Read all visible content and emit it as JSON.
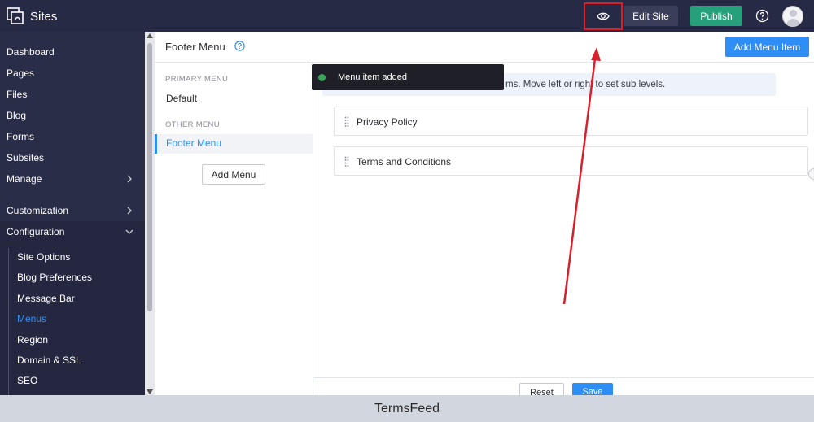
{
  "app": {
    "name": "Sites"
  },
  "topbar": {
    "edit_label": "Edit Site",
    "publish_label": "Publish",
    "icons": [
      "preview-eye-icon",
      "help-icon",
      "avatar"
    ]
  },
  "sidebar": {
    "items": [
      {
        "label": "Dashboard"
      },
      {
        "label": "Pages"
      },
      {
        "label": "Files"
      },
      {
        "label": "Blog"
      },
      {
        "label": "Forms"
      },
      {
        "label": "Subsites"
      },
      {
        "label": "Manage"
      },
      {
        "label": "Customization"
      },
      {
        "label": "Configuration"
      }
    ],
    "sub_items": [
      {
        "label": "Site Options"
      },
      {
        "label": "Blog Preferences"
      },
      {
        "label": "Message Bar"
      },
      {
        "label": "Menus"
      },
      {
        "label": "Region"
      },
      {
        "label": "Domain & SSL"
      },
      {
        "label": "SEO"
      }
    ],
    "active_sub_item": "Menus"
  },
  "page": {
    "title": "Footer Menu",
    "add_item_label": "Add Menu Item"
  },
  "menus": {
    "primary_heading": "PRIMARY MENU",
    "primary_items": [
      "Default"
    ],
    "other_heading": "OTHER MENU",
    "other_items": [
      "Footer Menu"
    ],
    "selected": "Footer Menu",
    "add_menu_label": "Add Menu"
  },
  "hint": {
    "text": "ms. Move left or right to set sub levels."
  },
  "toast": {
    "text": "Menu item added",
    "status_color": "#3ba55d"
  },
  "menu_items": [
    {
      "label": "Privacy Policy"
    },
    {
      "label": "Terms and Conditions"
    }
  ],
  "footer": {
    "reset_label": "Reset",
    "save_label": "Save"
  },
  "caption": "TermsFeed",
  "colors": {
    "accent": "#2f8ef5",
    "publish": "#25a07b",
    "highlight": "#d9202a",
    "sidebar": "#2a2d47"
  }
}
